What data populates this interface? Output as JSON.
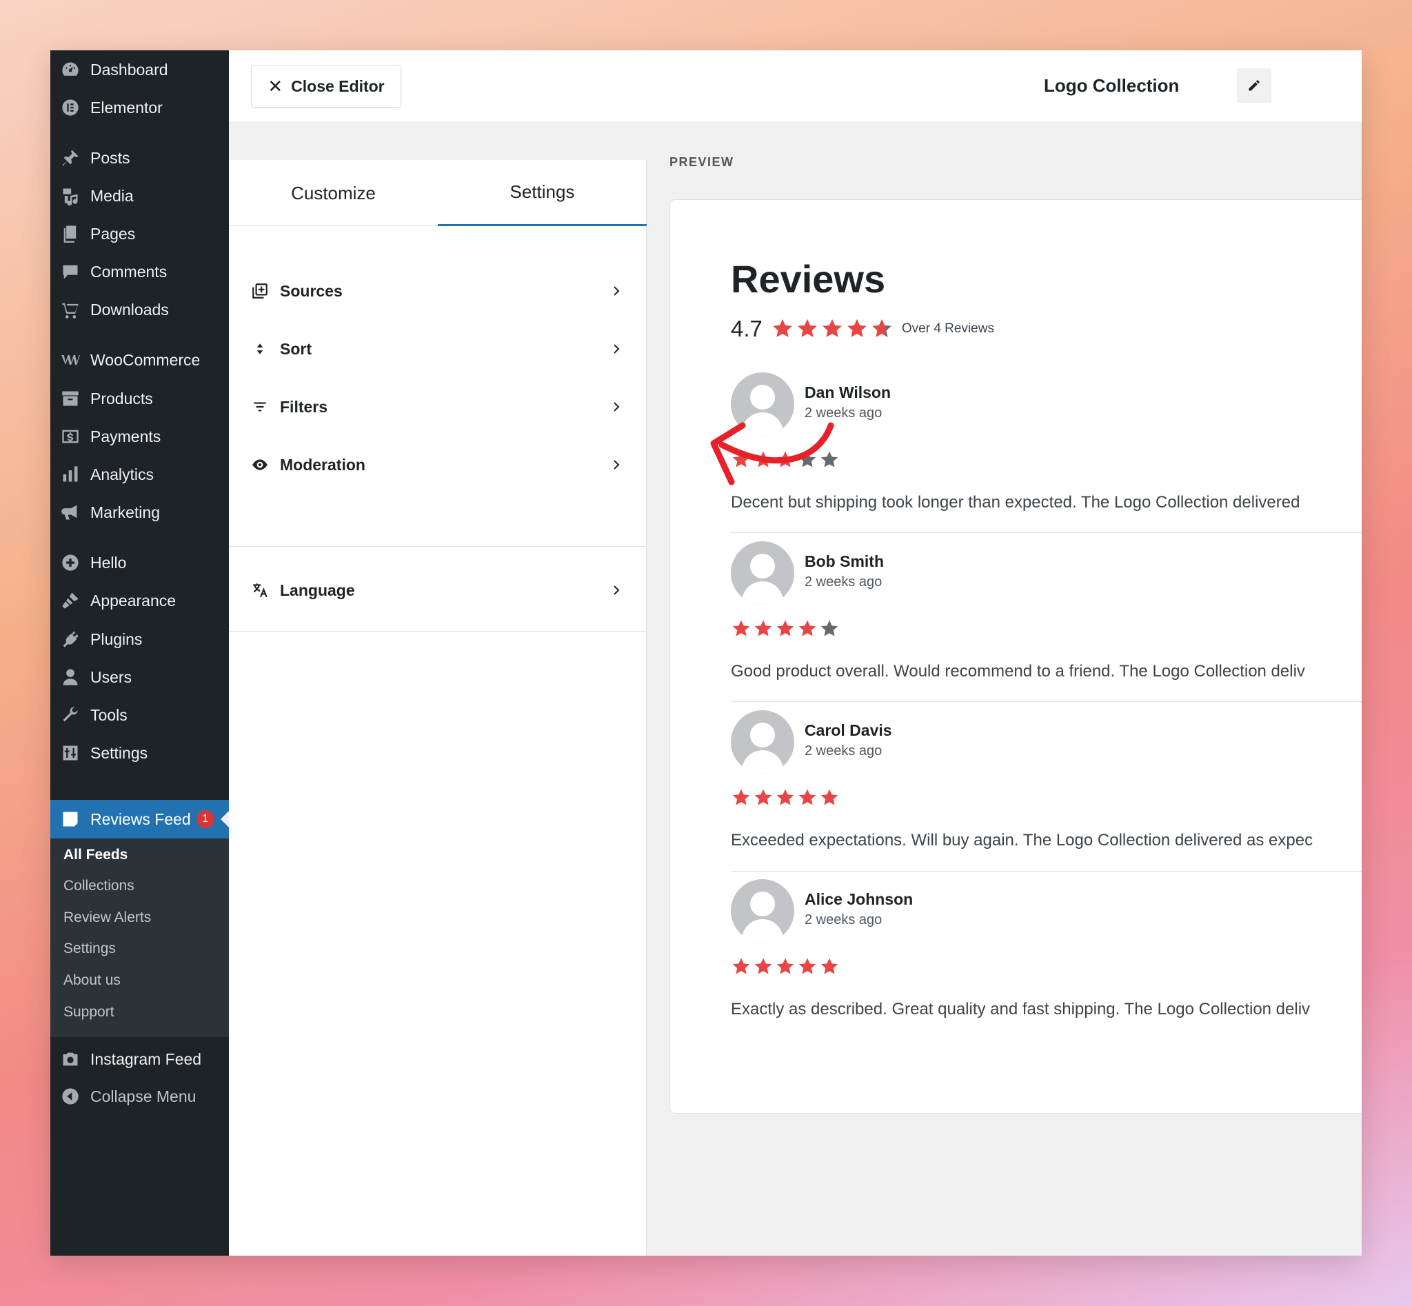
{
  "sidebar": {
    "items": [
      {
        "label": "Dashboard",
        "icon": "dashboard-icon"
      },
      {
        "label": "Elementor",
        "icon": "elementor-icon"
      },
      {
        "label": "Posts",
        "icon": "pin-icon"
      },
      {
        "label": "Media",
        "icon": "media-icon"
      },
      {
        "label": "Pages",
        "icon": "pages-icon"
      },
      {
        "label": "Comments",
        "icon": "comment-icon"
      },
      {
        "label": "Downloads",
        "icon": "cart-icon"
      },
      {
        "label": "WooCommerce",
        "icon": "woo-icon"
      },
      {
        "label": "Products",
        "icon": "archive-icon"
      },
      {
        "label": "Payments",
        "icon": "dollar-icon"
      },
      {
        "label": "Analytics",
        "icon": "bar-chart-icon"
      },
      {
        "label": "Marketing",
        "icon": "megaphone-icon"
      },
      {
        "label": "Hello",
        "icon": "plus-circle-icon"
      },
      {
        "label": "Appearance",
        "icon": "brush-icon"
      },
      {
        "label": "Plugins",
        "icon": "plug-icon"
      },
      {
        "label": "Users",
        "icon": "user-icon"
      },
      {
        "label": "Tools",
        "icon": "wrench-icon"
      },
      {
        "label": "Settings",
        "icon": "sliders-icon"
      },
      {
        "label": "Reviews Feed",
        "icon": "star-badge-icon",
        "badge": "1"
      },
      {
        "label": "Instagram Feed",
        "icon": "camera-icon"
      },
      {
        "label": "Collapse Menu",
        "icon": "collapse-icon"
      }
    ],
    "submenu": [
      "All Feeds",
      "Collections",
      "Review Alerts",
      "Settings",
      "About us",
      "Support"
    ]
  },
  "topbar": {
    "close_label": "Close Editor",
    "collection_name": "Logo Collection"
  },
  "panel": {
    "tabs": [
      "Customize",
      "Settings"
    ],
    "active_tab": "Settings",
    "rows": [
      {
        "label": "Sources",
        "icon": "add-source-icon"
      },
      {
        "label": "Sort",
        "icon": "sort-icon"
      },
      {
        "label": "Filters",
        "icon": "filter-icon"
      },
      {
        "label": "Moderation",
        "icon": "eye-icon"
      },
      {
        "label": "Language",
        "icon": "translate-icon"
      }
    ]
  },
  "preview": {
    "label": "PREVIEW",
    "title": "Reviews",
    "average": "4.7",
    "average_value": 4.7,
    "count_text": "Over 4 Reviews",
    "reviews": [
      {
        "name": "Dan Wilson",
        "time": "2 weeks ago",
        "rating": 3,
        "text": "Decent but shipping took longer than expected. The Logo Collection delivered"
      },
      {
        "name": "Bob Smith",
        "time": "2 weeks ago",
        "rating": 4,
        "text": "Good product overall. Would recommend to a friend. The Logo Collection deliv"
      },
      {
        "name": "Carol Davis",
        "time": "2 weeks ago",
        "rating": 5,
        "text": "Exceeded expectations. Will buy again. The Logo Collection delivered as expec"
      },
      {
        "name": "Alice Johnson",
        "time": "2 weeks ago",
        "rating": 5,
        "text": "Exactly as described. Great quality and fast shipping. The Logo Collection deliv"
      }
    ]
  },
  "colors": {
    "star_filled": "#e84545",
    "star_empty": "#646970",
    "accent": "#2271b1",
    "annotation": "#e8202a"
  }
}
